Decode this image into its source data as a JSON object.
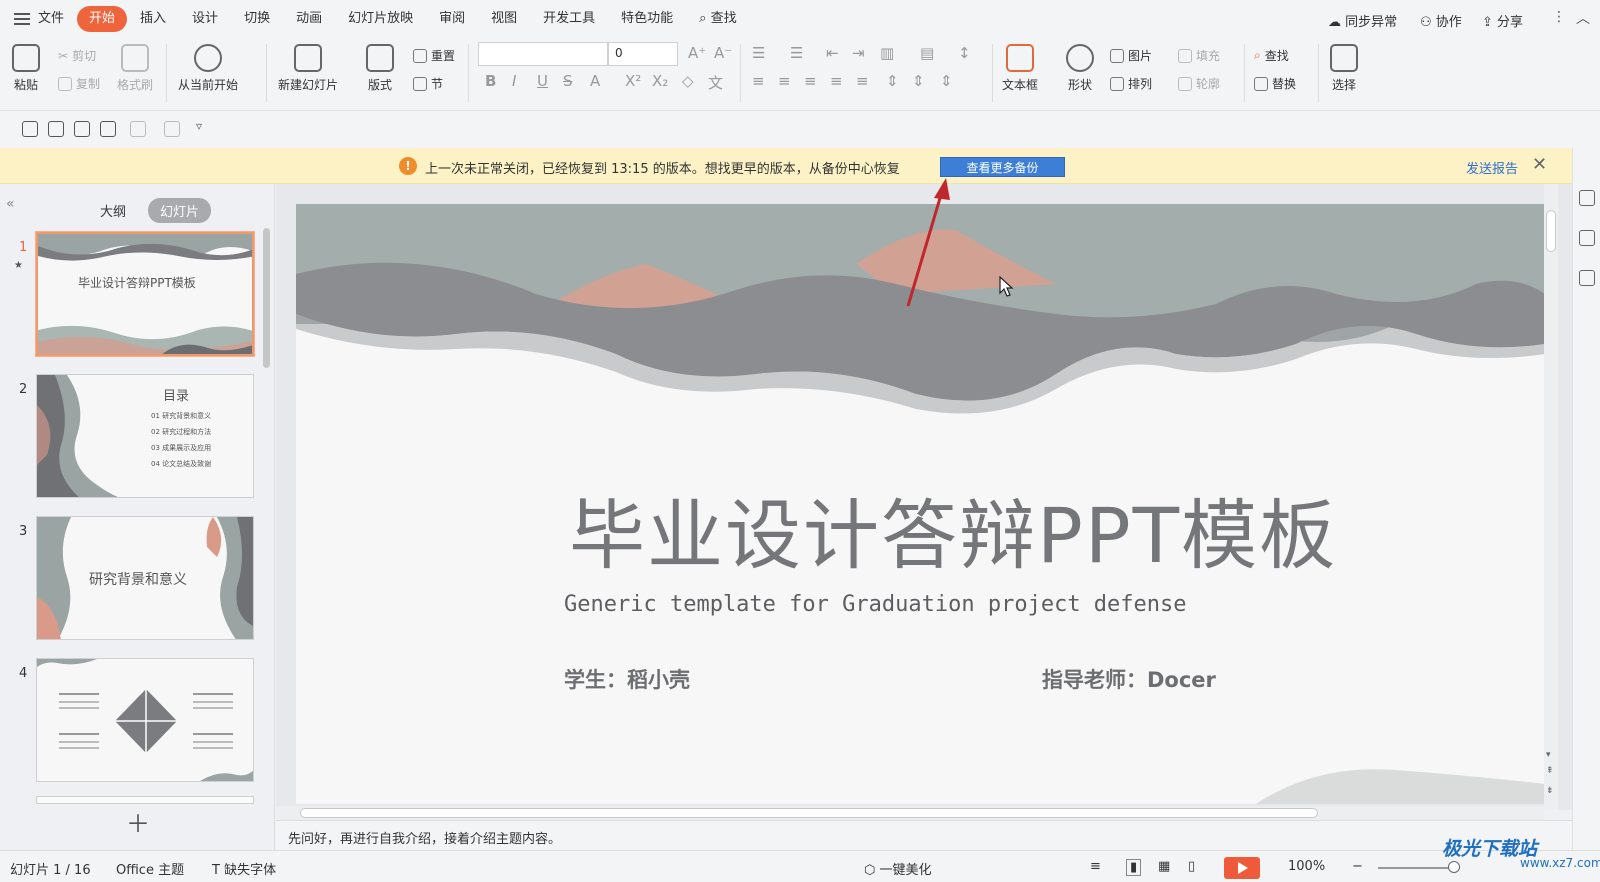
{
  "menubar": {
    "file": "文件",
    "tabs": [
      "开始",
      "插入",
      "设计",
      "切换",
      "动画",
      "幻灯片放映",
      "审阅",
      "视图",
      "开发工具",
      "特色功能"
    ],
    "active_tab": "开始",
    "search": "查找",
    "sync": "同步异常",
    "collab": "协作",
    "share": "分享"
  },
  "ribbon": {
    "paste": "粘贴",
    "cut": "剪切",
    "copy": "复制",
    "format_painter": "格式刷",
    "from_current": "从当前开始",
    "new_slide": "新建幻灯片",
    "layout": "版式",
    "reset": "重置",
    "section": "节",
    "font_size": "0",
    "text_box": "文本框",
    "shape": "形状",
    "picture": "图片",
    "fill": "填充",
    "arrange": "排列",
    "outline": "轮廓",
    "find": "查找",
    "replace": "替换",
    "select": "选择"
  },
  "notification": {
    "icon": "!",
    "text": "上一次未正常关闭，已经恢复到 13:15 的版本。想找更早的版本，从备份中心恢复",
    "button": "查看更多备份",
    "report": "发送报告"
  },
  "panel": {
    "tab_outline": "大纲",
    "tab_slides": "幻灯片",
    "thumbnails": [
      {
        "num": "1",
        "title": "毕业设计答辩PPT模板"
      },
      {
        "num": "2",
        "title": "目录",
        "items": [
          "01  研究背景和意义",
          "02  研究过程和方法",
          "03  成果展示及应用",
          "04  论文总结及致谢"
        ]
      },
      {
        "num": "3",
        "title": "研究背景和意义"
      },
      {
        "num": "4",
        "title": ""
      }
    ]
  },
  "slide": {
    "title": "毕业设计答辩PPT模板",
    "subtitle": "Generic template for Graduation project defense",
    "student": "学生：稻小壳",
    "teacher": "指导老师：Docer"
  },
  "notes": "先问好，再进行自我介绍，接着介绍主题内容。",
  "status": {
    "slide_count": "幻灯片 1 / 16",
    "theme": "Office 主题",
    "missing_font": "缺失字体",
    "beautify": "一键美化",
    "zoom": "100%"
  },
  "watermark": {
    "line1": "极光下载站",
    "line2": "www.xz7.com"
  },
  "colors": {
    "accent": "#f0643c",
    "link": "#2f6fcf",
    "banner": "#fdf2c6",
    "button": "#3d7fd6"
  }
}
